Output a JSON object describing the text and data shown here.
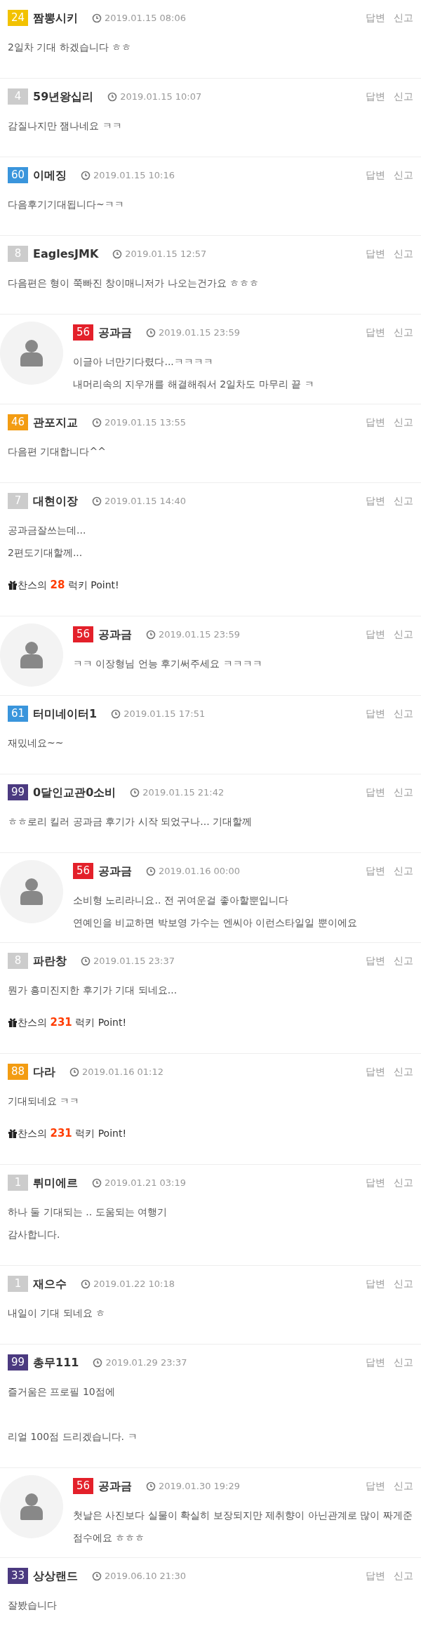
{
  "comments": [
    {
      "kind": "comment",
      "level_label": "24",
      "color": "#f2c200",
      "name": "짬뽕시키",
      "time": "2019.01.15 08:06",
      "actions": [
        "답변",
        "신고"
      ],
      "lines": [
        "2일차 기대 하겠습니다 ㅎㅎ"
      ]
    },
    {
      "kind": "comment",
      "level_label": "4",
      "color": "#cccccc",
      "name": "59년왕십리",
      "time": "2019.01.15 10:07",
      "actions": [
        "답변",
        "신고"
      ],
      "lines": [
        "감질나지만 잼나네요 ㅋㅋ"
      ]
    },
    {
      "kind": "comment",
      "level_label": "60",
      "color": "#3a95dc",
      "name": "이메징",
      "time": "2019.01.15 10:16",
      "actions": [
        "답변",
        "신고"
      ],
      "lines": [
        "다음후기기대됩니다~ㅋㅋ"
      ]
    },
    {
      "kind": "comment",
      "level_label": "8",
      "color": "#cccccc",
      "name": "EaglesJMK",
      "time": "2019.01.15 12:57",
      "actions": [
        "답변",
        "신고"
      ],
      "lines": [
        "다음편은 형이 쭉빠진 창이매니저가 나오는건가요 ㅎㅎㅎ"
      ]
    },
    {
      "kind": "reply",
      "level_label": "56",
      "color": "#e3202a",
      "name": "공과금",
      "time": "2019.01.15 23:59",
      "actions": [
        "답변",
        "신고"
      ],
      "lines": [
        "이글아 너만기다렸다...ㅋㅋㅋㅋ",
        "내머리속의 지우개를 해결해줘서 2일차도 마무리 끝 ㅋ"
      ]
    },
    {
      "kind": "comment",
      "level_label": "46",
      "color": "#f39c12",
      "name": "관포지교",
      "time": "2019.01.15 13:55",
      "actions": [
        "답변",
        "신고"
      ],
      "lines": [
        "다음편 기대합니다^^"
      ]
    },
    {
      "kind": "comment",
      "level_label": "7",
      "color": "#cccccc",
      "name": "대현이장",
      "time": "2019.01.15 14:40",
      "actions": [
        "답변",
        "신고"
      ],
      "lines": [
        "공과금잘쓰는데...",
        "2편도기대할께..."
      ],
      "lucky": {
        "before": "찬스의",
        "points": "28",
        "after": "럭키 Point!"
      }
    },
    {
      "kind": "reply",
      "level_label": "56",
      "color": "#e3202a",
      "name": "공과금",
      "time": "2019.01.15 23:59",
      "actions": [
        "답변",
        "신고"
      ],
      "lines": [
        "ㅋㅋ 이장형님 언능 후기써주세요 ㅋㅋㅋㅋ"
      ]
    },
    {
      "kind": "comment",
      "level_label": "61",
      "color": "#3a95dc",
      "name": "터미네이터1",
      "time": "2019.01.15 17:51",
      "actions": [
        "답변",
        "신고"
      ],
      "lines": [
        "재밌네요~~"
      ]
    },
    {
      "kind": "comment",
      "level_label": "99",
      "color": "#4b3a80",
      "name": "0달인교관0소비",
      "time": "2019.01.15 21:42",
      "actions": [
        "답변",
        "신고"
      ],
      "lines": [
        "ㅎㅎ로리 킬러 공과금 후기가 시작 되었구나... 기대할께"
      ]
    },
    {
      "kind": "reply",
      "level_label": "56",
      "color": "#e3202a",
      "name": "공과금",
      "time": "2019.01.16 00:00",
      "actions": [
        "답변",
        "신고"
      ],
      "lines": [
        "소비형 노리라니요.. 전 귀여운걸 좋아할뿐입니다",
        "연예인을 비교하면 박보영 가수는 엔씨아 이런스타일일 뿐이에요"
      ]
    },
    {
      "kind": "comment",
      "level_label": "8",
      "color": "#cccccc",
      "name": "파란창",
      "time": "2019.01.15 23:37",
      "actions": [
        "답변",
        "신고"
      ],
      "lines": [
        "뭔가 흥미진지한 후기가 기대 되네요..."
      ],
      "lucky": {
        "before": "찬스의",
        "points": "231",
        "after": "럭키 Point!"
      }
    },
    {
      "kind": "comment",
      "level_label": "88",
      "color": "#f39c12",
      "name": "다라",
      "time": "2019.01.16 01:12",
      "actions": [
        "답변",
        "신고"
      ],
      "lines": [
        "기대되네요 ㅋㅋ"
      ],
      "lucky": {
        "before": "찬스의",
        "points": "231",
        "after": "럭키 Point!"
      }
    },
    {
      "kind": "comment",
      "level_label": "1",
      "color": "#cccccc",
      "name": "뤼미에르",
      "time": "2019.01.21 03:19",
      "actions": [
        "답변",
        "신고"
      ],
      "lines": [
        "하나 둘 기대되는 .. 도움되는 여행기",
        "감사합니다."
      ]
    },
    {
      "kind": "comment",
      "level_label": "1",
      "color": "#cccccc",
      "name": "재으수",
      "time": "2019.01.22 10:18",
      "actions": [
        "답변",
        "신고"
      ],
      "lines": [
        "내일이 기대 되네요 ㅎ"
      ]
    },
    {
      "kind": "comment",
      "level_label": "99",
      "color": "#4b3a80",
      "name": "총무111",
      "time": "2019.01.29 23:37",
      "actions": [
        "답변",
        "신고"
      ],
      "paragraphs": [
        "즐거움은 프로필 10점에",
        "리얼 100점 드리겠습니다. ㅋ"
      ]
    },
    {
      "kind": "reply",
      "level_label": "56",
      "color": "#e3202a",
      "name": "공과금",
      "time": "2019.01.30 19:29",
      "actions": [
        "답변",
        "신고"
      ],
      "lines": [
        "첫날은 사진보다 실물이 확실히 보장되지만 제취향이 아닌관계로 많이 짜게준 점수에요 ㅎㅎㅎ"
      ]
    },
    {
      "kind": "comment",
      "level_label": "33",
      "color": "#4b3a80",
      "name": "상상랜드",
      "time": "2019.06.10 21:30",
      "actions": [
        "답변",
        "신고"
      ],
      "lines": [
        "잘봤습니다"
      ]
    }
  ]
}
